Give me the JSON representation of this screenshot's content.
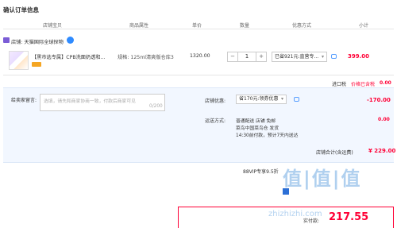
{
  "page": {
    "title": "确认订单信息"
  },
  "table_headers": [
    "店铺宝贝",
    "商品属性",
    "单价",
    "数量",
    "优惠方式",
    "小计"
  ],
  "shop": {
    "name": "店铺: 天猫国际全球探物"
  },
  "item": {
    "name": "【黑市选专属】CPB洗面奶透和...",
    "spec": "规格: 125ml清爽版仓库3",
    "unit_price": "1320.00",
    "quantity": "1",
    "qty_minus": "−",
    "qty_plus": "+",
    "promo_select": "已省921元:直营专...",
    "subtotal": "399.00"
  },
  "tax": {
    "label": "进口税",
    "value": "价格已含税",
    "amount": "0.00"
  },
  "message": {
    "label": "给卖家留言:",
    "placeholder": "选填，请先和商家协商一致，付款后商家可见",
    "count": "0/200"
  },
  "store_discount": {
    "label": "店铺优惠:",
    "selected": "省170元:领券优惠",
    "amount": "-170.00"
  },
  "shipping": {
    "label": "运送方式:",
    "line1": "普通配送 店铺 免邮",
    "line2": "菜鸟中国菜鸟仓 发货",
    "line3": "14:30前付款，预计7天内送达",
    "amount": "0.00"
  },
  "store_total": {
    "label": "店铺合计(含运费)",
    "amount": "¥ 229.00"
  },
  "vip": {
    "text": "88VIP专享9.5折"
  },
  "payment": {
    "label": "实付款:",
    "amount": "217.55"
  },
  "watermark": {
    "line1": "值|值|值",
    "line2": "zhizhizhi.com"
  },
  "colors": {
    "accent_red": "#ff0036",
    "panel_blue": "#f2f7ff",
    "brand_blue": "#2c6fd6"
  }
}
